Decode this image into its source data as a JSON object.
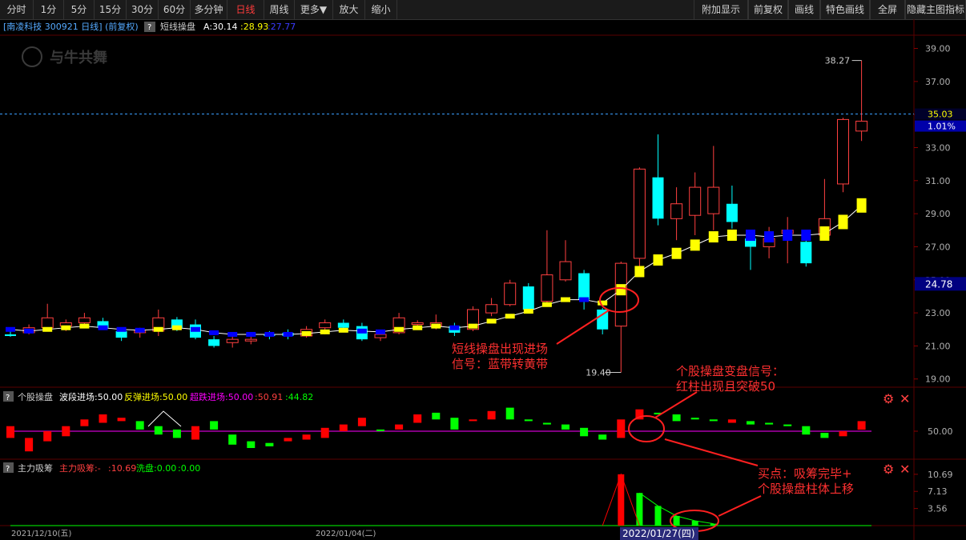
{
  "toolbar": {
    "left": [
      "分时",
      "1分",
      "5分",
      "15分",
      "30分",
      "60分",
      "多分钟",
      "日线",
      "周线",
      "更多▼",
      "放大",
      "缩小"
    ],
    "active": "日线",
    "right": [
      "附加显示",
      "前复权",
      "画线",
      "特色画线",
      "全屏",
      "隐藏主图指标"
    ]
  },
  "stock": {
    "title": "[南凌科技 300921 日线] (前复权)",
    "indicator_name": "短线操盘",
    "indicator_a": "A:30.14",
    "indicator_b": ":28.93",
    "indicator_c": ":27.77",
    "watermark": "与牛共舞"
  },
  "main_price": {
    "current_price": "35.03",
    "change_pct": "1.01%",
    "marker_price": "24.78",
    "high_label": "38.27",
    "low_label": "19.40"
  },
  "annotations": {
    "a1_line1": "短线操盘出现进场",
    "a1_line2": "信号：蓝带转黄带",
    "a2_line1": "个股操盘变盘信号：",
    "a2_line2": "红柱出现且突破50",
    "a3_line1": "买点：吸筹完毕+",
    "a3_line2": "个股操盘柱体上移"
  },
  "panel2": {
    "name": "个股操盘",
    "p1": "波段进场:50.00",
    "p2": "反弹进场:50.00",
    "p3": "超跌进场:50.00",
    "p4": ":50.91",
    "p5": ":44.82",
    "axis_label": "50.00"
  },
  "panel3": {
    "name": "主力吸筹",
    "p1": "主力吸筹:-",
    "p1b": ":10.69",
    "p2": "洗盘:0.00",
    "p3": ":0.00",
    "ticks": [
      "10.69",
      "7.13",
      "3.56"
    ]
  },
  "dates": [
    "2021/12/10(五)",
    "2022/01/04(二)",
    "2022/01/27(四)"
  ],
  "colors": {
    "up": "#ff4040",
    "down": "#00ffff",
    "yellow": "#ffff00",
    "blue": "#0000ff",
    "green": "#00ff00",
    "magenta": "#ff00ff",
    "bg": "#000000"
  },
  "chart_data": {
    "type": "candlestick",
    "y_ticks": [
      39.0,
      37.0,
      35.0,
      33.0,
      31.0,
      29.0,
      27.0,
      25.0,
      23.0,
      21.0,
      19.0
    ],
    "ylim": [
      18.6,
      39.8
    ],
    "candles": [
      [
        21.7,
        21.6,
        21.95,
        21.55
      ],
      [
        21.8,
        22.1,
        22.3,
        21.7
      ],
      [
        22.1,
        22.7,
        23.55,
        22.0
      ],
      [
        22.2,
        22.4,
        22.6,
        21.9
      ],
      [
        22.4,
        22.7,
        23.0,
        22.2
      ],
      [
        22.5,
        22.1,
        22.7,
        22.0
      ],
      [
        21.9,
        21.5,
        22.1,
        21.3
      ],
      [
        21.8,
        21.9,
        22.1,
        21.5
      ],
      [
        21.9,
        22.7,
        23.2,
        21.6
      ],
      [
        22.6,
        22.1,
        22.75,
        21.9
      ],
      [
        22.3,
        21.5,
        22.6,
        21.4
      ],
      [
        21.4,
        21.0,
        21.6,
        20.9
      ],
      [
        21.2,
        21.4,
        21.6,
        20.9
      ],
      [
        21.3,
        21.4,
        21.7,
        21.1
      ],
      [
        21.7,
        21.6,
        21.9,
        21.4
      ],
      [
        21.8,
        21.6,
        22.0,
        21.4
      ],
      [
        21.6,
        22.0,
        22.2,
        21.5
      ],
      [
        22.1,
        22.4,
        22.6,
        21.7
      ],
      [
        22.4,
        22.1,
        22.6,
        22.0
      ],
      [
        22.2,
        21.4,
        22.4,
        21.3
      ],
      [
        21.5,
        21.7,
        21.95,
        21.3
      ],
      [
        21.8,
        22.7,
        23.0,
        21.7
      ],
      [
        22.3,
        22.4,
        22.55,
        22.2
      ],
      [
        22.2,
        22.4,
        22.9,
        22.0
      ],
      [
        22.2,
        21.8,
        22.4,
        21.6
      ],
      [
        22.0,
        23.2,
        23.4,
        21.9
      ],
      [
        23.0,
        23.5,
        23.9,
        22.8
      ],
      [
        23.5,
        24.8,
        25.0,
        23.4
      ],
      [
        24.6,
        23.2,
        24.8,
        23.1
      ],
      [
        23.7,
        25.3,
        28.0,
        23.5
      ],
      [
        25.0,
        26.1,
        27.4,
        24.9
      ],
      [
        25.4,
        23.8,
        25.6,
        23.2
      ],
      [
        23.2,
        22.0,
        23.3,
        21.7
      ],
      [
        22.2,
        26.0,
        26.1,
        19.4
      ],
      [
        26.3,
        31.7,
        31.8,
        25.3
      ],
      [
        31.2,
        28.7,
        33.8,
        28.3
      ],
      [
        28.7,
        29.6,
        30.6,
        27.4
      ],
      [
        28.9,
        30.6,
        31.5,
        27.7
      ],
      [
        29.0,
        30.6,
        33.1,
        28.0
      ],
      [
        29.6,
        28.5,
        30.7,
        28.1
      ],
      [
        27.5,
        27.0,
        27.9,
        25.6
      ],
      [
        27.0,
        27.5,
        28.2,
        26.3
      ],
      [
        27.8,
        28.0,
        28.8,
        26.0
      ],
      [
        27.3,
        26.0,
        27.6,
        25.8
      ],
      [
        27.7,
        28.7,
        31.1,
        27.4
      ],
      [
        30.8,
        34.7,
        34.8,
        30.3
      ],
      [
        34.0,
        34.6,
        38.27,
        33.4
      ]
    ],
    "band": [
      [
        22.0,
        1
      ],
      [
        21.9,
        1
      ],
      [
        22.0,
        0
      ],
      [
        22.1,
        0
      ],
      [
        22.2,
        0
      ],
      [
        22.1,
        1
      ],
      [
        22.0,
        1
      ],
      [
        21.95,
        1
      ],
      [
        22.0,
        0
      ],
      [
        22.1,
        0
      ],
      [
        22.0,
        1
      ],
      [
        21.8,
        1
      ],
      [
        21.7,
        1
      ],
      [
        21.7,
        1
      ],
      [
        21.7,
        1
      ],
      [
        21.7,
        1
      ],
      [
        21.75,
        0
      ],
      [
        21.85,
        0
      ],
      [
        21.95,
        0
      ],
      [
        21.9,
        1
      ],
      [
        21.85,
        1
      ],
      [
        22.0,
        0
      ],
      [
        22.1,
        0
      ],
      [
        22.2,
        0
      ],
      [
        22.1,
        1
      ],
      [
        22.2,
        0
      ],
      [
        22.5,
        0
      ],
      [
        22.8,
        0
      ],
      [
        23.1,
        0
      ],
      [
        23.5,
        0
      ],
      [
        23.8,
        0
      ],
      [
        23.8,
        1
      ],
      [
        23.6,
        0
      ],
      [
        24.4,
        0
      ],
      [
        25.5,
        0
      ],
      [
        26.2,
        0
      ],
      [
        26.6,
        0
      ],
      [
        27.1,
        0
      ],
      [
        27.6,
        0
      ],
      [
        27.7,
        0
      ],
      [
        27.7,
        1
      ],
      [
        27.6,
        1
      ],
      [
        27.7,
        1
      ],
      [
        27.7,
        1
      ],
      [
        27.8,
        0
      ],
      [
        28.5,
        0
      ],
      [
        29.5,
        0
      ]
    ],
    "panel2_bars": [
      [
        53,
        46,
        1
      ],
      [
        46,
        38,
        1
      ],
      [
        50,
        44,
        1
      ],
      [
        47,
        53,
        1
      ],
      [
        53,
        57,
        1
      ],
      [
        55,
        60,
        1
      ],
      [
        56,
        58,
        1
      ],
      [
        56,
        51,
        0
      ],
      [
        53,
        48,
        0
      ],
      [
        51,
        46,
        0
      ],
      [
        53,
        45,
        1
      ],
      [
        56,
        51,
        0
      ],
      [
        48,
        42,
        0
      ],
      [
        44,
        40,
        0
      ],
      [
        43,
        41,
        0
      ],
      [
        44,
        46,
        1
      ],
      [
        45,
        48,
        1
      ],
      [
        46,
        52,
        1
      ],
      [
        50,
        54,
        1
      ],
      [
        53,
        58,
        1
      ],
      [
        51,
        50,
        0
      ],
      [
        51,
        54,
        1
      ],
      [
        55,
        60,
        1
      ],
      [
        61,
        57,
        0
      ],
      [
        58,
        51,
        0
      ],
      [
        56,
        57,
        1
      ],
      [
        57,
        62,
        1
      ],
      [
        64,
        57,
        0
      ],
      [
        57,
        56,
        0
      ],
      [
        55,
        54,
        0
      ],
      [
        54,
        51,
        0
      ],
      [
        52,
        47,
        0
      ],
      [
        48,
        45,
        0
      ],
      [
        46,
        57,
        1
      ],
      [
        57,
        63,
        1
      ],
      [
        61,
        60,
        0
      ],
      [
        60,
        56,
        0
      ],
      [
        58,
        57,
        0
      ],
      [
        57,
        56,
        0
      ],
      [
        57,
        55,
        1
      ],
      [
        56,
        54,
        0
      ],
      [
        55,
        54,
        0
      ],
      [
        54,
        53,
        0
      ],
      [
        53,
        48,
        0
      ],
      [
        49,
        46,
        0
      ],
      [
        47,
        50,
        1
      ],
      [
        50.9,
        56,
        1
      ]
    ],
    "panel2_line": 50.0,
    "panel3_bars": [
      [
        33,
        10.69,
        1
      ],
      [
        34,
        6.8,
        0
      ],
      [
        35,
        4.1,
        0
      ],
      [
        36,
        2.0,
        0
      ],
      [
        37,
        1.0,
        0
      ],
      [
        38,
        0.4,
        0
      ]
    ],
    "panel3_ticks": [
      10.69,
      7.13,
      3.56
    ]
  }
}
